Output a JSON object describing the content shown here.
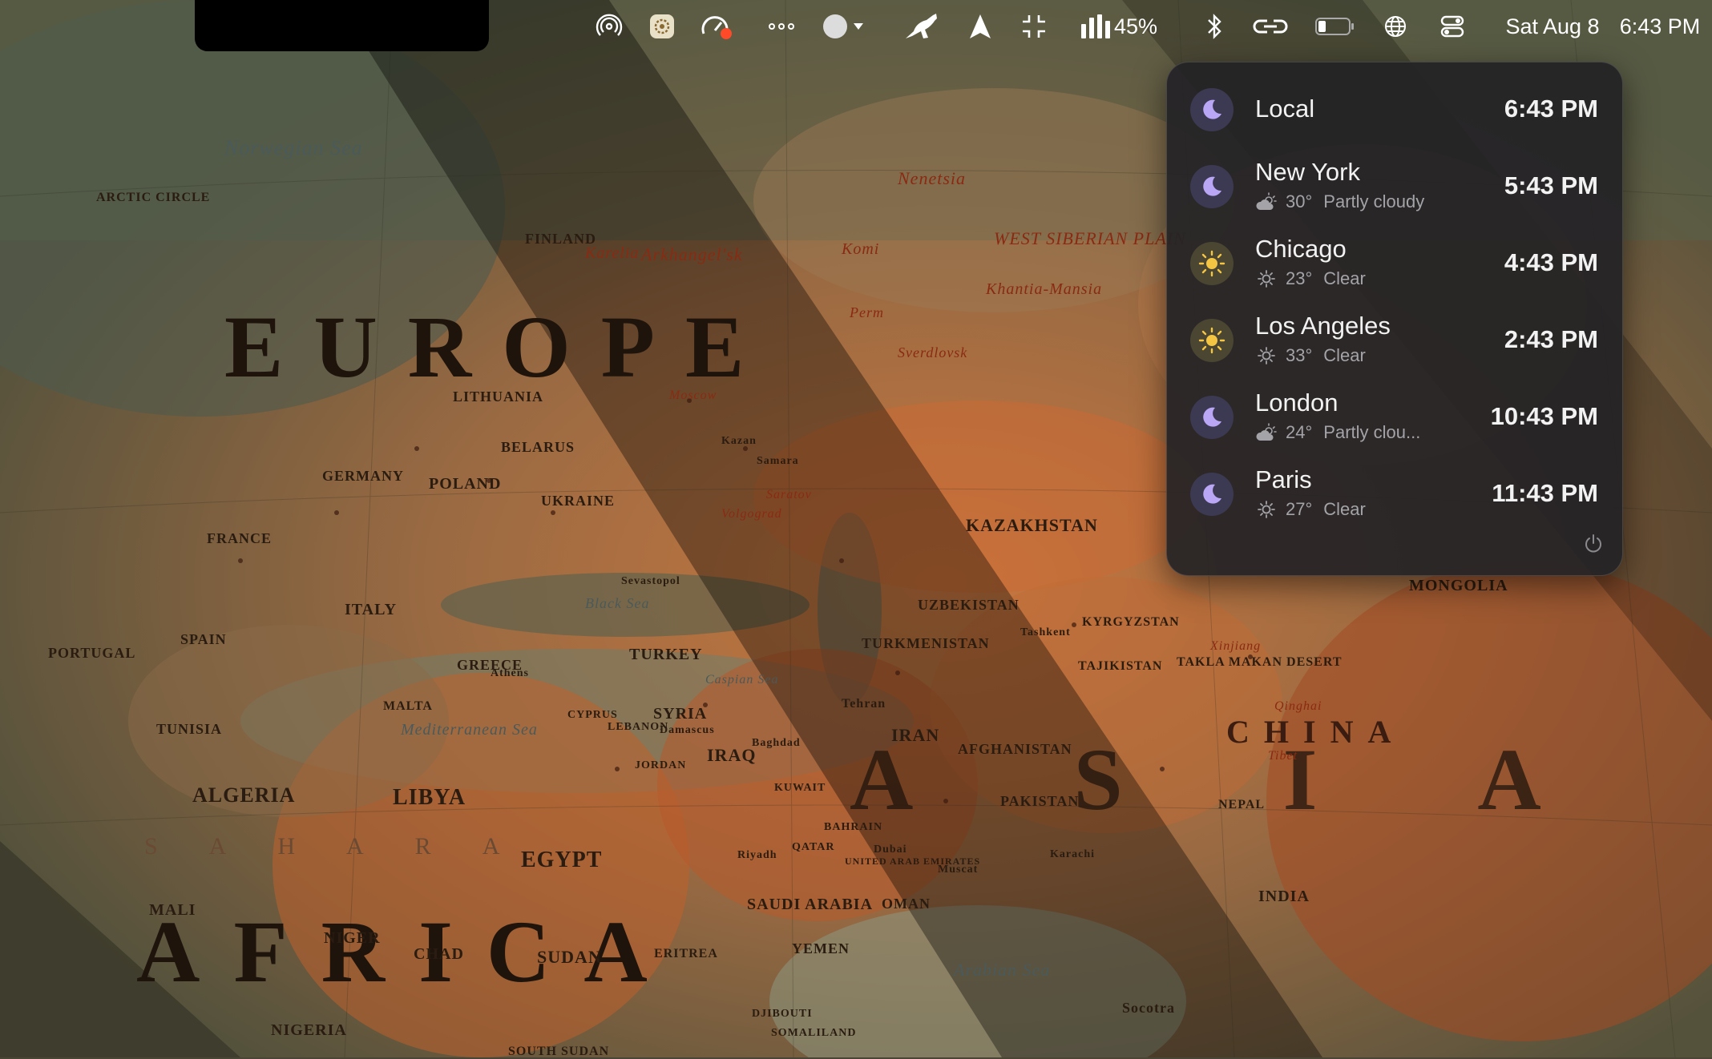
{
  "menubar": {
    "icons": [
      "airdrop-icon",
      "settings-app-icon",
      "gauge-icon",
      "ellipsis-icon",
      "appearance-toggle-icon",
      "kangaroo-icon",
      "location-arrow-icon",
      "resize-arrows-icon",
      "cpu-bars-icon",
      "battery-icon",
      "bluetooth-icon",
      "link-icon",
      "low-battery-icon",
      "globe-icon",
      "control-center-icon"
    ],
    "battery_percent": "45%",
    "date": "Sat Aug 8",
    "time": "6:43 PM"
  },
  "world_clock": {
    "rows": [
      {
        "city": "Local",
        "time": "6:43 PM",
        "daylight_icon": "moon-icon",
        "temp": "",
        "condition": "",
        "weather_icon": ""
      },
      {
        "city": "New York",
        "time": "5:43 PM",
        "daylight_icon": "moon-icon",
        "temp": "30°",
        "condition": "Partly cloudy",
        "weather_icon": "partly-cloudy-icon"
      },
      {
        "city": "Chicago",
        "time": "4:43 PM",
        "daylight_icon": "sun-icon",
        "temp": "23°",
        "condition": "Clear",
        "weather_icon": "clear-sun-icon"
      },
      {
        "city": "Los Angeles",
        "time": "2:43 PM",
        "daylight_icon": "sun-icon",
        "temp": "33°",
        "condition": "Clear",
        "weather_icon": "clear-sun-icon"
      },
      {
        "city": "London",
        "time": "10:43 PM",
        "daylight_icon": "moon-icon",
        "temp": "24°",
        "condition": "Partly clou...",
        "weather_icon": "partly-cloudy-icon"
      },
      {
        "city": "Paris",
        "time": "11:43 PM",
        "daylight_icon": "moon-icon",
        "temp": "27°",
        "condition": "Clear",
        "weather_icon": "clear-sun-icon"
      }
    ],
    "power_icon": "power-icon"
  },
  "wallpaper": {
    "large_labels": {
      "europe": "EUROPE",
      "africa": "AFRICA",
      "asia": "ASIA",
      "sahara": "SAHARA",
      "china": "CHINA"
    },
    "labels": [
      "Norwegian Sea",
      "ARCTIC CIRCLE",
      "FINLAND",
      "Karelia",
      "Arkhangel'sk",
      "Komi",
      "Nenetsia",
      "WEST SIBERIAN PLAIN",
      "Khantia-Mansia",
      "Perm",
      "Sverdlovsk",
      "LITHUANIA",
      "BELARUS",
      "POLAND",
      "GERMANY",
      "UKRAINE",
      "FRANCE",
      "ITALY",
      "SPAIN",
      "PORTUGAL",
      "GREECE",
      "TURKEY",
      "SYRIA",
      "IRAQ",
      "IRAN",
      "KAZAKHSTAN",
      "UZBEKISTAN",
      "TURKMENISTAN",
      "KYRGYZSTAN",
      "TAJIKISTAN",
      "AFGHANISTAN",
      "PAKISTAN",
      "MONGOLIA",
      "INDIA",
      "Mediterranean Sea",
      "Black Sea",
      "Caspian Sea",
      "Arabian Sea",
      "ALGERIA",
      "LIBYA",
      "EGYPT",
      "TUNISIA",
      "MALTA",
      "CYPRUS",
      "LEBANON",
      "JORDAN",
      "KUWAIT",
      "QATAR",
      "BAHRAIN",
      "SAUDI ARABIA",
      "OMAN",
      "YEMEN",
      "ERITREA",
      "SUDAN",
      "CHAD",
      "NIGER",
      "MALI",
      "NIGERIA",
      "SOUTH SUDAN",
      "DJIBOUTI",
      "SOMALILAND",
      "UNITED ARAB EMIRATES",
      "Moscow",
      "Kazan",
      "Samara",
      "Saratov",
      "Volgograd",
      "Sevastopol",
      "Athens",
      "Damascus",
      "Baghdad",
      "Tehran",
      "Riyadh",
      "Dubai",
      "Muscat",
      "Karachi",
      "Tashkent",
      "Xinjiang",
      "TAKLA MAKAN DESERT",
      "Socotra",
      "Qinghai",
      "Tibet",
      "NEPAL"
    ]
  }
}
